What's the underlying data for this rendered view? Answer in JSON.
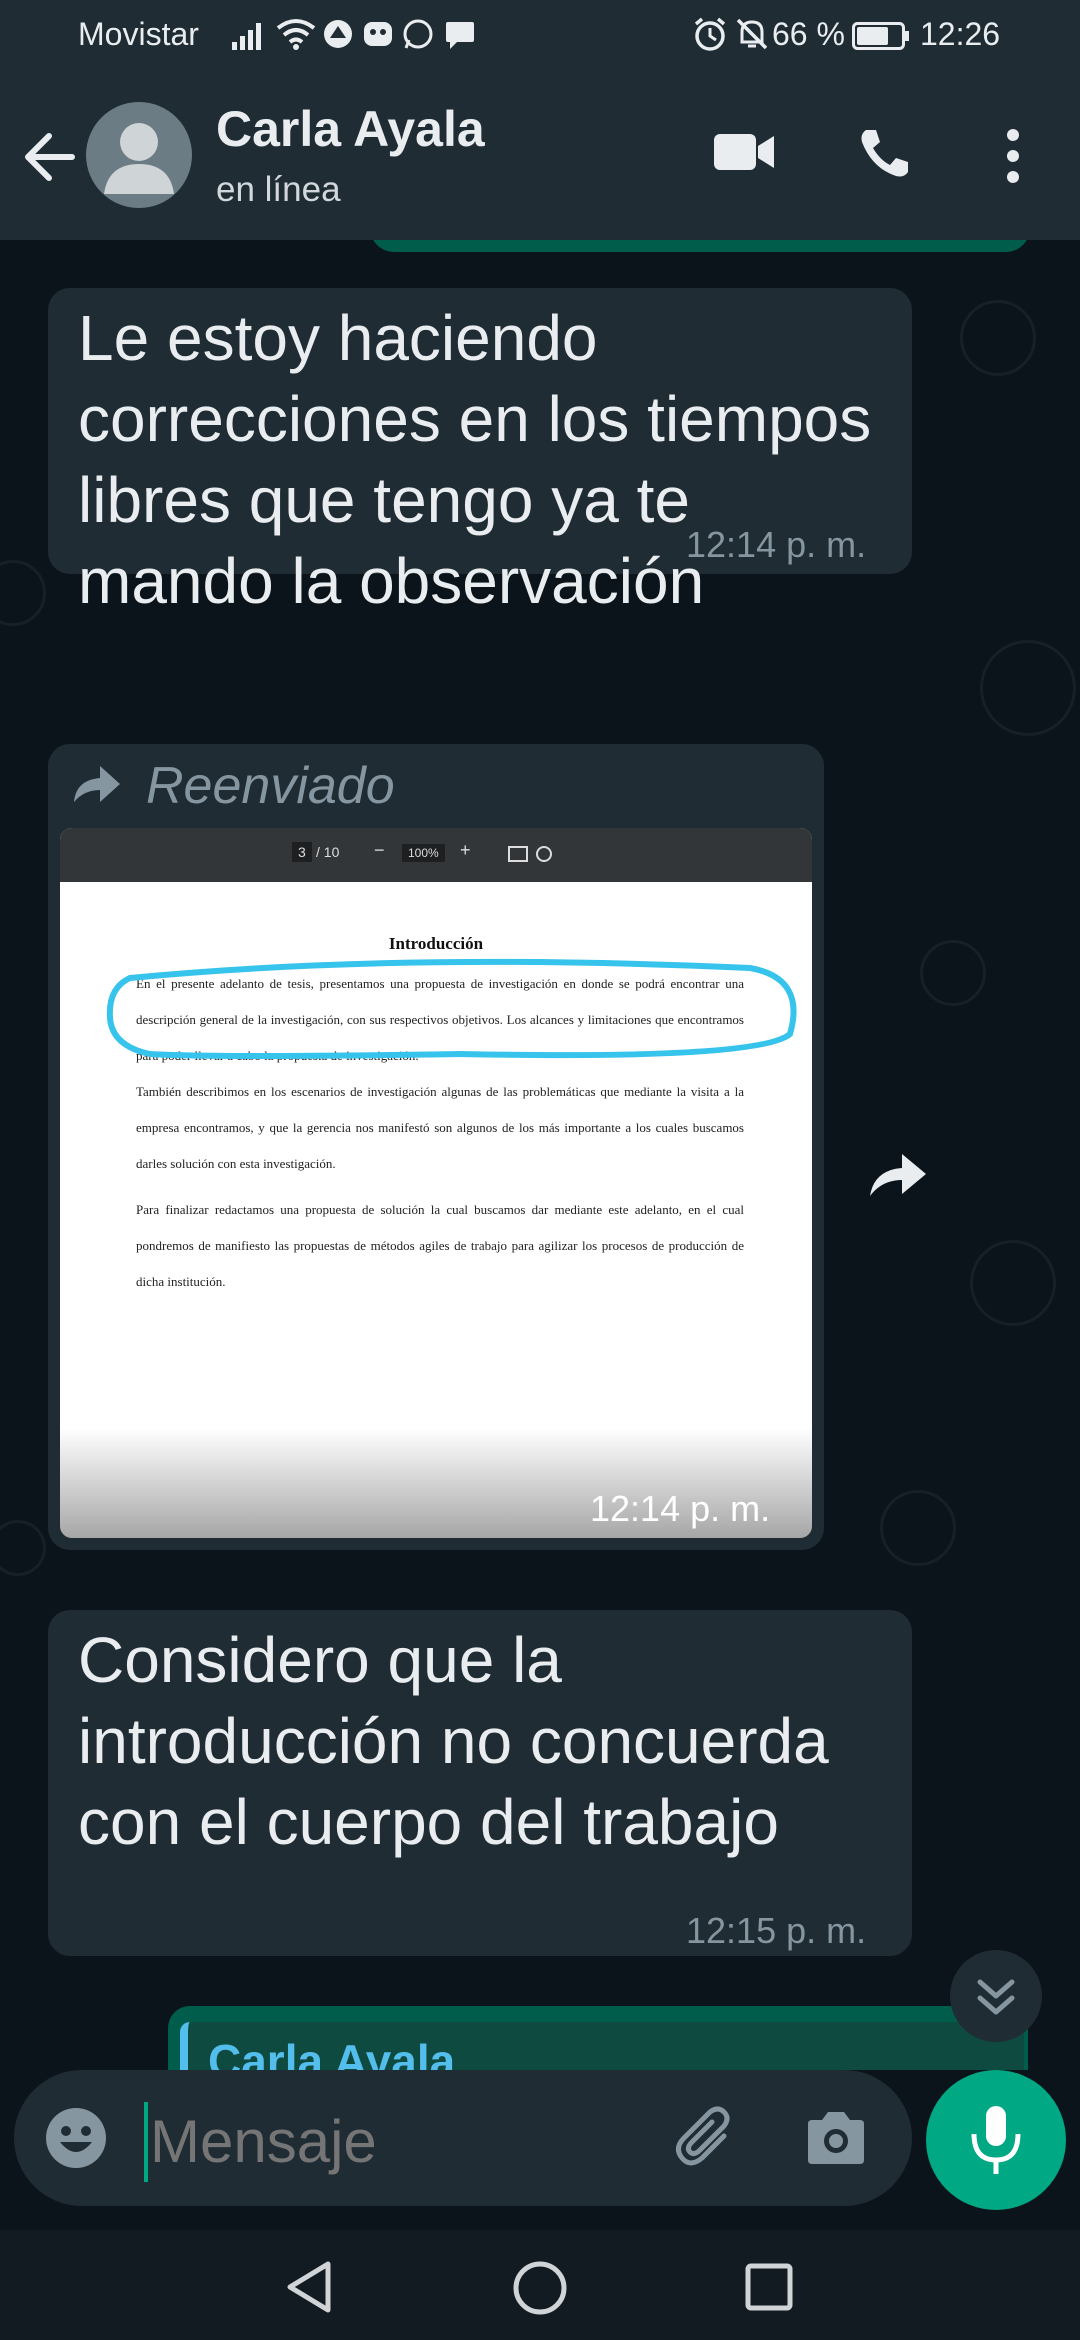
{
  "status_bar": {
    "carrier": "Movistar",
    "battery": "66 %",
    "time": "12:26"
  },
  "header": {
    "contact_name": "Carla Ayala",
    "status": "en línea"
  },
  "messages": [
    {
      "text": "Le estoy haciendo correcciones en los tiempos libres que tengo ya te mando la observación",
      "time": "12:14 p. m."
    },
    {
      "forwarded_label": "Reenviado",
      "time": "12:14 p. m.",
      "document": {
        "page": "3",
        "pages": "/ 10",
        "zoom": "100%",
        "title": "Introducción",
        "paragraph1": "En el presente adelanto de tesis, presentamos una propuesta de investigación en donde se podrá encontrar una descripción general de la investigación, con sus respectivos objetivos. Los alcances y limitaciones que encontramos para poder llevar a cabo la propuesta de investigación.",
        "paragraph2": "También describimos en los escenarios de investigación algunas de las problemáticas que mediante la visita a la empresa encontramos, y que la gerencia nos manifestó son algunos de los más importante a los cuales buscamos darles solución con esta investigación.",
        "paragraph3": "Para finalizar redactamos una propuesta de solución la cual buscamos dar mediante este adelanto, en el cual pondremos de manifiesto las propuestas de métodos agiles de trabajo para agilizar los procesos de producción de dicha institución."
      }
    },
    {
      "text": "Considero que la introducción no concuerda con el cuerpo del trabajo",
      "time": "12:15 p. m."
    }
  ],
  "partial_reply_name": "Carla Ayala",
  "input": {
    "placeholder": "Mensaje"
  },
  "colors": {
    "accent": "#00a884",
    "header": "#1f2c34",
    "background": "#0b141a",
    "bubble_in": "#1f2c34",
    "highlight": "#36c3ec"
  }
}
